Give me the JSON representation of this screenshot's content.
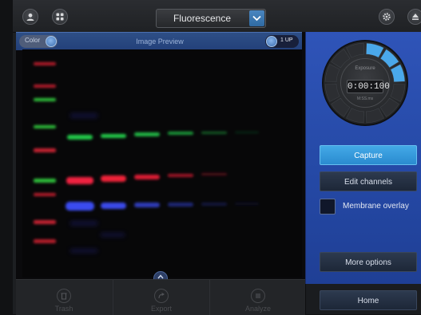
{
  "topbar": {
    "mode_value": "Fluorescence",
    "left_icons": [
      "user-icon",
      "grid-icon"
    ],
    "right_icons": [
      "gear-icon",
      "eject-icon"
    ]
  },
  "preview": {
    "title": "Image Preview",
    "color_label": "Color",
    "view_label": "1 UP",
    "lane_colors": {
      "green": "#22c84a",
      "red": "#e8213a",
      "blue": "#3b4cf0",
      "ladder_red": "#c42030",
      "ladder_green": "#2fbf3a"
    }
  },
  "toolbar": {
    "trash_label": "Trash",
    "export_label": "Export",
    "analyze_label": "Analyze"
  },
  "exposure": {
    "caption": "Exposure",
    "value": "0:00:100",
    "subcaption": "M:SS.ms"
  },
  "panel": {
    "capture_label": "Capture",
    "edit_channels_label": "Edit channels",
    "membrane_overlay_label": "Membrane overlay",
    "membrane_overlay_checked": false,
    "more_options_label": "More options",
    "home_label": "Home"
  },
  "colors": {
    "accent": "#2a8bd0",
    "panel_blue": "#2549a6",
    "dial_highlight": "#4aa8ea"
  }
}
